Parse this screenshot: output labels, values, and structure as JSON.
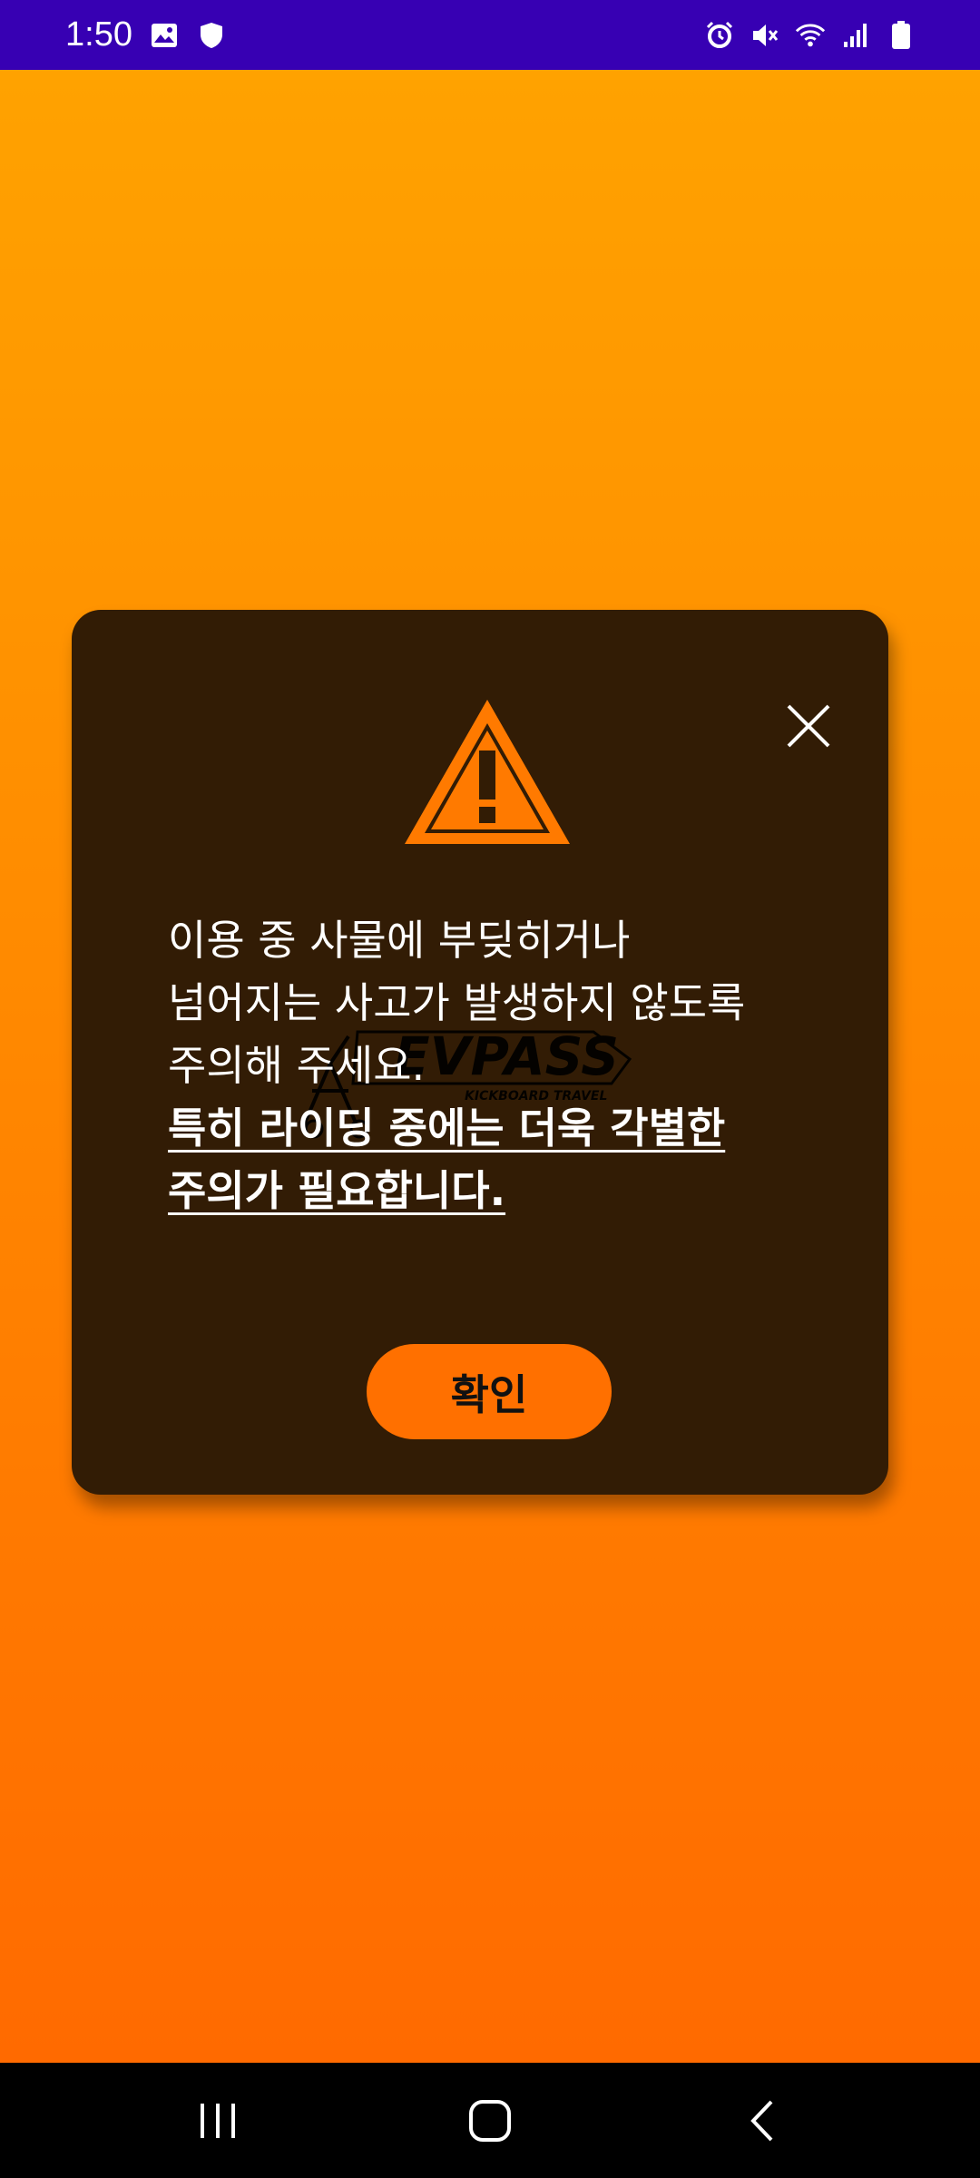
{
  "status_bar": {
    "time": "1:50",
    "left_icons": [
      "gallery-icon",
      "shield-icon"
    ],
    "right_icons": [
      "alarm-icon",
      "mute-icon",
      "wifi-icon",
      "signal-icon",
      "battery-icon"
    ],
    "background": "#3700b3"
  },
  "dialog": {
    "icon": "warning-icon",
    "close_icon": "close-icon",
    "watermark_text": "EVPASS",
    "watermark_subtext": "KICKBOARD TRAVEL",
    "message_lines": [
      "이용 중 사물에 부딪히거나",
      "넘어지는 사고가 발생하지 않도록",
      "주의해 주세요."
    ],
    "emphasis_lines": [
      "특히 라이딩 중에는 더욱 각별한",
      "주의가 필요합니다."
    ],
    "confirm_label": "확인",
    "background": "#321c05",
    "accent": "#ff7000"
  },
  "nav_bar": {
    "items": [
      "recent-apps-icon",
      "home-icon",
      "back-icon"
    ]
  }
}
